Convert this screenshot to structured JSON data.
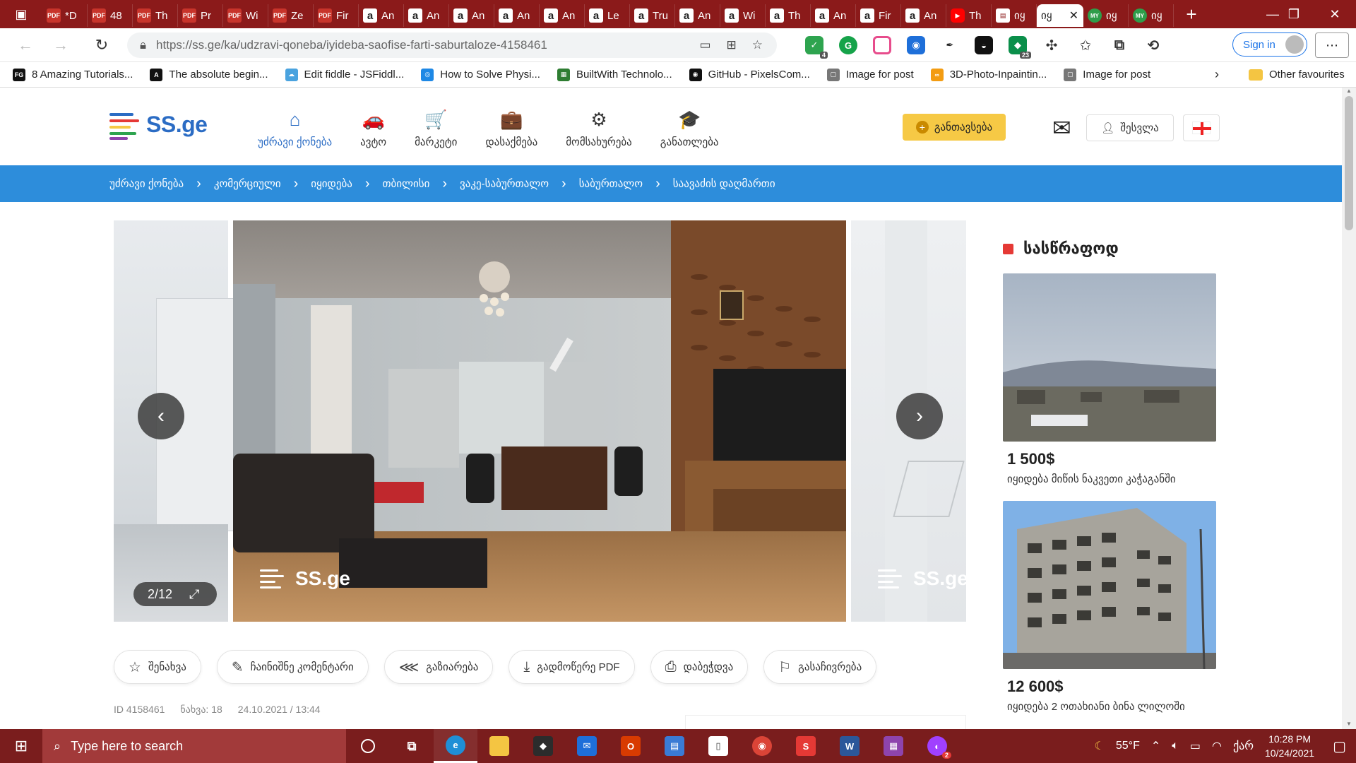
{
  "browser": {
    "tabs": [
      {
        "icon": "PDF",
        "label": "*D",
        "type": "pdf"
      },
      {
        "icon": "PDF",
        "label": "48",
        "type": "pdf"
      },
      {
        "icon": "PDF",
        "label": "Th",
        "type": "pdf"
      },
      {
        "icon": "PDF",
        "label": "Pr",
        "type": "pdf"
      },
      {
        "icon": "PDF",
        "label": "Wi",
        "type": "pdf"
      },
      {
        "icon": "PDF",
        "label": "Ze",
        "type": "pdf"
      },
      {
        "icon": "PDF",
        "label": "Fir",
        "type": "pdf"
      },
      {
        "icon": "a",
        "label": "An",
        "type": "amz"
      },
      {
        "icon": "a",
        "label": "An",
        "type": "amz"
      },
      {
        "icon": "a",
        "label": "An",
        "type": "amz"
      },
      {
        "icon": "a",
        "label": "An",
        "type": "amz"
      },
      {
        "icon": "a",
        "label": "An",
        "type": "amz"
      },
      {
        "icon": "a",
        "label": "Le",
        "type": "amz"
      },
      {
        "icon": "a",
        "label": "Tru",
        "type": "amz"
      },
      {
        "icon": "a",
        "label": "An",
        "type": "amz"
      },
      {
        "icon": "a",
        "label": "Wi",
        "type": "amz"
      },
      {
        "icon": "a",
        "label": "Th",
        "type": "amz"
      },
      {
        "icon": "a",
        "label": "An",
        "type": "amz"
      },
      {
        "icon": "a",
        "label": "Fir",
        "type": "amz"
      },
      {
        "icon": "a",
        "label": "An",
        "type": "amz"
      },
      {
        "icon": "▶",
        "label": "Th",
        "type": "yt"
      },
      {
        "icon": "▤",
        "label": "იყ",
        "type": "doc"
      }
    ],
    "active_tab": {
      "label": "იყ"
    },
    "tabs_after": [
      {
        "icon": "MY",
        "label": "იყ"
      },
      {
        "icon": "MY",
        "label": "იყ"
      }
    ],
    "url": "https://ss.ge/ka/udzravi-qoneba/iyideba-saofise-farti-saburtaloze-4158461",
    "signin_label": "Sign in",
    "ext_badges": {
      "first": "4",
      "second": "23"
    },
    "bookmarks": [
      {
        "icon": "FG",
        "label": "8 Amazing Tutorials...",
        "color": "#111"
      },
      {
        "icon": "A",
        "label": "The absolute begin...",
        "color": "#111"
      },
      {
        "icon": "☁",
        "label": "Edit fiddle - JSFiddl...",
        "color": "#4aa3df"
      },
      {
        "icon": "◎",
        "label": "How to Solve Physi...",
        "color": "#1e88e5"
      },
      {
        "icon": "▦",
        "label": "BuiltWith Technolo...",
        "color": "#2e7d32"
      },
      {
        "icon": "◉",
        "label": "GitHub - PixelsCom...",
        "color": "#111"
      },
      {
        "icon": "▢",
        "label": "Image for post",
        "color": "#777"
      },
      {
        "icon": "∞",
        "label": "3D-Photo-Inpaintin...",
        "color": "#f39c12"
      },
      {
        "icon": "▢",
        "label": "Image for post",
        "color": "#777"
      }
    ],
    "other_favourites": "Other favourites"
  },
  "site": {
    "logo_text": "SS.ge",
    "nav": [
      {
        "label": "უძრავი ქონება",
        "icon": "⌂",
        "active": true
      },
      {
        "label": "ავტო",
        "icon": "🚗",
        "active": false
      },
      {
        "label": "მარკეტი",
        "icon": "🛒",
        "active": false
      },
      {
        "label": "დასაქმება",
        "icon": "💼",
        "active": false
      },
      {
        "label": "მომსახურება",
        "icon": "⚙",
        "active": false
      },
      {
        "label": "განათლება",
        "icon": "🎓",
        "active": false
      }
    ],
    "add_button": "განთავსება",
    "login_button": "შესვლა",
    "breadcrumbs": [
      "უძრავი ქონება",
      "კომერციული",
      "იყიდება",
      "თბილისი",
      "ვაკე-საბურთალო",
      "საბურთალო",
      "საავაძის დაღმართი"
    ],
    "gallery": {
      "counter": "2/12",
      "watermark": "SS.ge",
      "watermark_right": "SS.ge"
    },
    "actions": [
      {
        "label": "შენახვა",
        "icon": "☆"
      },
      {
        "label": "ჩაინიშნე კომენტარი",
        "icon": "✎"
      },
      {
        "label": "გაზიარება",
        "icon": "⋘"
      },
      {
        "label": "გადმოწერე PDF",
        "icon": "⤓"
      },
      {
        "label": "დაბეჭდვა",
        "icon": "⎙"
      },
      {
        "label": "გასაჩივრება",
        "icon": "⚐"
      }
    ],
    "meta": {
      "id": "ID 4158461",
      "views": "ნახვა: 18",
      "date": "24.10.2021",
      "time": "13:44",
      "date_sep": "/"
    },
    "sidebar": {
      "title": "სასწრაფოდ",
      "cards": [
        {
          "price": "1 500",
          "currency": "$",
          "desc": "იყიდება მიწის ნაკვეთი კაჭაგანში"
        },
        {
          "price": "12 600",
          "currency": "$",
          "desc": "იყიდება 2 ოთახიანი ბინა ლილოში"
        }
      ]
    }
  },
  "taskbar": {
    "search_placeholder": "Type here to search",
    "weather": "55°F",
    "lang": "ქარ",
    "time": "10:28 PM",
    "date": "10/24/2021",
    "badge": "2"
  },
  "colors": {
    "tabstrip": "#8b1a1a",
    "brand_blue": "#2b6cc4",
    "breadcrumb_bar": "#2d8ddb",
    "add_button": "#f6c945",
    "urgent_red": "#e53935",
    "taskbar": "#7a1d1d"
  }
}
